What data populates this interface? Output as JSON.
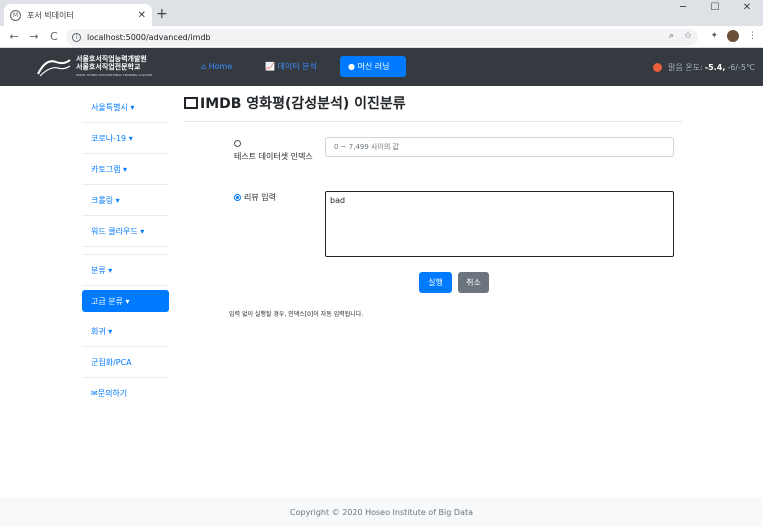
{
  "browser": {
    "tab_title": "포서 빅데이터",
    "tab_close": "✕",
    "new_tab": "+",
    "url": "localhost:5000/advanced/imdb",
    "back": "←",
    "forward": "→",
    "reload": "C"
  },
  "navbar": {
    "logo_line1": "서울호서직업능력개발원",
    "logo_line2": "서울호서직업전문학교",
    "logo_line3": "SEOUL HOSEO OCCUPATIONAL TRAINING COLLEGE",
    "items": [
      {
        "label": "Home",
        "icon": "home-icon"
      },
      {
        "label": "데이터 분석",
        "icon": "chart-icon"
      },
      {
        "label": "머신 러닝",
        "icon": "brain-icon"
      }
    ],
    "weather_label": "맑음 온도:",
    "weather_temp": "-5.4,",
    "weather_range": "-6/-5℃"
  },
  "sidebar": {
    "items": [
      "서울특별시",
      "코로나-19",
      "카토그램",
      "크롤링",
      "워드 클라우드"
    ],
    "items2": [
      "분류",
      "고급 분류",
      "회귀",
      "군집화/PCA",
      "문의하기"
    ]
  },
  "main": {
    "title": "IMDB 영화평(감성분석) 이진분류",
    "option1_label": "테스트 데이터셋 인덱스",
    "option1_placeholder": "0 ~ 7,499 사이의 값",
    "option2_label": "리뷰 입력",
    "review_text": "bad",
    "run_label": "실행",
    "cancel_label": "취소",
    "note": "입력 없이 실행될 경우, 인덱스[0]이 자동 입력됩니다."
  },
  "footer": {
    "text": "Copyright © 2020 Hoseo Institute of Big Data"
  }
}
